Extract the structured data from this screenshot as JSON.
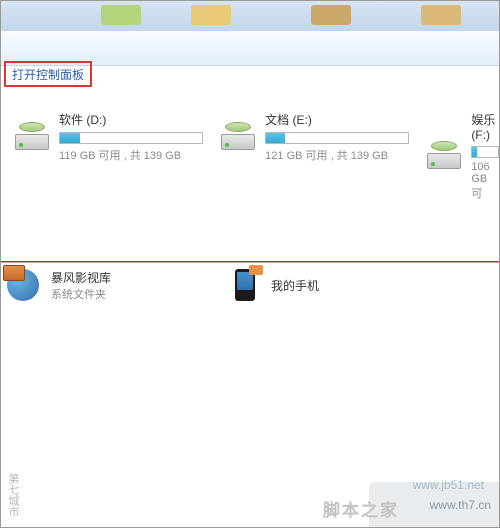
{
  "toolbar": {
    "controlPanelLink": "打开控制面板"
  },
  "drives": [
    {
      "label": "软件 (D:)",
      "free": "119 GB 可用 , 共 139 GB",
      "fillPct": 14
    },
    {
      "label": "文档 (E:)",
      "free": "121 GB 可用 , 共 139 GB",
      "fillPct": 13
    },
    {
      "label": "娱乐 (F:)",
      "free": "106 GB 可",
      "fillPct": 18
    }
  ],
  "items": [
    {
      "name": "暴风影视库",
      "sub": "系统文件夹",
      "icon": "globe-folder-icon"
    },
    {
      "name": "我的手机",
      "sub": "",
      "icon": "phone-icon"
    }
  ],
  "watermarks": {
    "site1": "www.jb51.net",
    "site2": "www.th7.cn",
    "site3": "第七城市",
    "site4": "脚本之家"
  }
}
